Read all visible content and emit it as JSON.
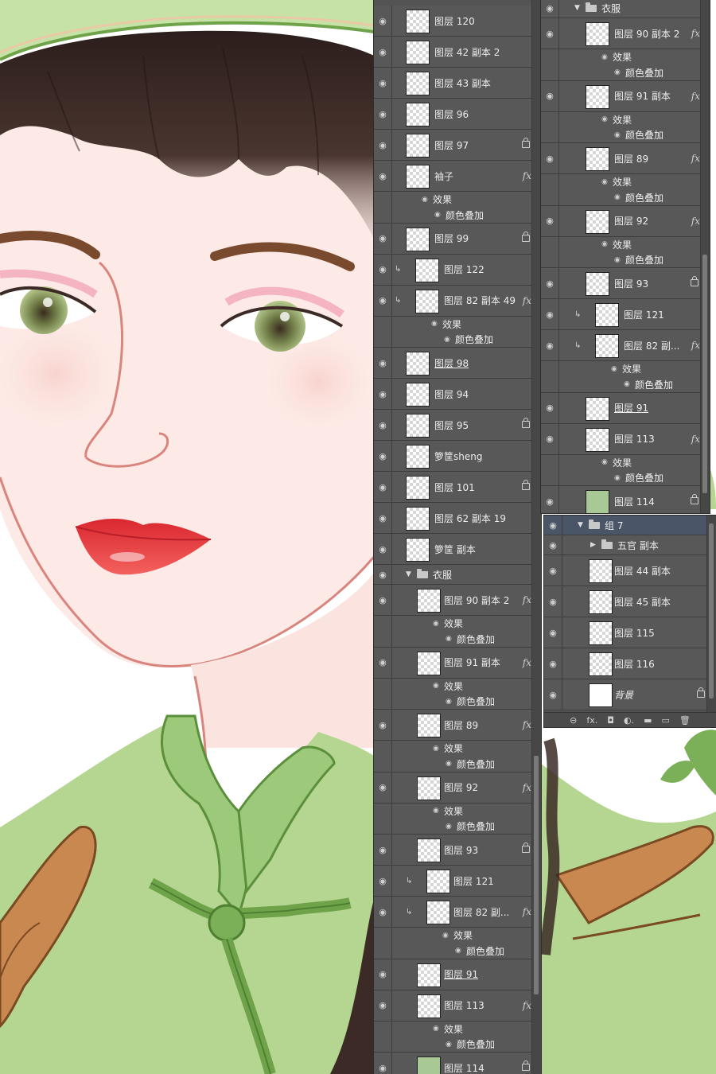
{
  "left_panel": {
    "top_layers": [
      {
        "name": "图层 120",
        "thumb": "pink",
        "fx": false,
        "lock": false,
        "clip": false
      },
      {
        "name": "图层 42 副本 2",
        "thumb": "check",
        "fx": false,
        "lock": false,
        "clip": false
      },
      {
        "name": "图层 43 副本",
        "thumb": "check",
        "fx": false,
        "lock": false,
        "clip": false
      },
      {
        "name": "图层 96",
        "thumb": "check",
        "fx": false,
        "lock": false,
        "clip": false
      },
      {
        "name": "图层 97",
        "thumb": "check",
        "fx": false,
        "lock": true,
        "clip": false
      },
      {
        "name": "袖子",
        "thumb": "check",
        "fx": true,
        "lock": false,
        "clip": false,
        "effects": [
          "效果",
          "颜色叠加"
        ]
      },
      {
        "name": "图层 99",
        "thumb": "check",
        "fx": false,
        "lock": true,
        "clip": false
      },
      {
        "name": "图层 122",
        "thumb": "check",
        "fx": false,
        "lock": false,
        "clip": true
      },
      {
        "name": "图层 82 副本 49",
        "thumb": "check",
        "fx": true,
        "lock": false,
        "clip": true,
        "effects": [
          "效果",
          "颜色叠加"
        ]
      },
      {
        "name": "图层 98",
        "thumb": "check",
        "fx": false,
        "lock": false,
        "clip": false,
        "underline": true
      },
      {
        "name": "图层 94",
        "thumb": "check",
        "fx": false,
        "lock": false,
        "clip": false
      },
      {
        "name": "图层 95",
        "thumb": "check",
        "fx": false,
        "lock": true,
        "clip": false
      },
      {
        "name": "箩筐sheng",
        "thumb": "check",
        "fx": false,
        "lock": false,
        "clip": false
      },
      {
        "name": "图层 101",
        "thumb": "check",
        "fx": false,
        "lock": true,
        "clip": false
      },
      {
        "name": "图层 62 副本 19",
        "thumb": "check",
        "fx": false,
        "lock": false,
        "clip": false
      },
      {
        "name": "箩筐 副本",
        "thumb": "check",
        "fx": false,
        "lock": false,
        "clip": false
      }
    ],
    "group": {
      "name": "衣服"
    },
    "group_layers": [
      {
        "name": "图层 90 副本 2",
        "fx": true,
        "lock": false,
        "clip": false,
        "effects": [
          "效果",
          "颜色叠加"
        ]
      },
      {
        "name": "图层 91 副本",
        "fx": true,
        "lock": false,
        "clip": false,
        "effects": [
          "效果",
          "颜色叠加"
        ]
      },
      {
        "name": "图层 89",
        "fx": true,
        "lock": false,
        "clip": false,
        "effects": [
          "效果",
          "颜色叠加"
        ]
      },
      {
        "name": "图层 92",
        "fx": true,
        "lock": false,
        "clip": false,
        "effects": [
          "效果",
          "颜色叠加"
        ]
      },
      {
        "name": "图层 93",
        "fx": false,
        "lock": true,
        "clip": false
      },
      {
        "name": "图层 121",
        "fx": false,
        "lock": false,
        "clip": true
      },
      {
        "name": "图层 82 副...",
        "fx": true,
        "lock": false,
        "clip": true,
        "effects": [
          "效果",
          "颜色叠加"
        ]
      },
      {
        "name": "图层 91",
        "fx": false,
        "lock": false,
        "clip": false,
        "underline": true
      },
      {
        "name": "图层 113",
        "fx": true,
        "lock": false,
        "clip": false,
        "effects": [
          "效果",
          "颜色叠加"
        ]
      },
      {
        "name": "图层 114",
        "fx": false,
        "lock": true,
        "clip": false,
        "thumb": "green"
      }
    ]
  },
  "right_panel_1": {
    "group": {
      "name": "衣服"
    },
    "layers": [
      {
        "name": "图层 90 副本 2",
        "fx": true,
        "lock": false,
        "clip": false,
        "effects": [
          "效果",
          "颜色叠加"
        ]
      },
      {
        "name": "图层 91 副本",
        "fx": true,
        "lock": false,
        "clip": false,
        "effects": [
          "效果",
          "颜色叠加"
        ]
      },
      {
        "name": "图层 89",
        "fx": true,
        "lock": false,
        "clip": false,
        "effects": [
          "效果",
          "颜色叠加"
        ]
      },
      {
        "name": "图层 92",
        "fx": true,
        "lock": false,
        "clip": false,
        "effects": [
          "效果",
          "颜色叠加"
        ]
      },
      {
        "name": "图层 93",
        "fx": false,
        "lock": true,
        "clip": false
      },
      {
        "name": "图层 121",
        "fx": false,
        "lock": false,
        "clip": true
      },
      {
        "name": "图层 82 副...",
        "fx": true,
        "lock": false,
        "clip": true,
        "effects": [
          "效果",
          "颜色叠加"
        ]
      },
      {
        "name": "图层 91",
        "fx": false,
        "lock": false,
        "clip": false,
        "underline": true
      },
      {
        "name": "图层 113",
        "fx": true,
        "lock": false,
        "clip": false,
        "effects": [
          "效果",
          "颜色叠加"
        ]
      },
      {
        "name": "图层 114",
        "fx": false,
        "lock": true,
        "clip": false,
        "thumb": "green"
      }
    ]
  },
  "right_panel_2": {
    "group": {
      "name": "组 7"
    },
    "subgroup": {
      "name": "五官 副本"
    },
    "layers": [
      {
        "name": "图层 44 副本",
        "lock": false
      },
      {
        "name": "图层 45 副本",
        "lock": false
      },
      {
        "name": "图层 115",
        "lock": false
      },
      {
        "name": "图层 116",
        "lock": false
      },
      {
        "name": "背景",
        "lock": true,
        "italic": true,
        "thumb": "white"
      }
    ],
    "footer_icons": [
      "link-icon",
      "fx-icon",
      "mask-icon",
      "adjustment-icon",
      "folder-icon",
      "new-layer-icon",
      "trash-icon"
    ],
    "footer_glyphs": [
      "⊖",
      "fx.",
      "◘",
      "◐.",
      "▬",
      "▭",
      "🗑"
    ]
  },
  "colors": {
    "panel_bg": "#535353",
    "row_bg": "#585858",
    "skin": "#fdeae6",
    "lips": "#e8383b",
    "cap_green": "#c7e2a6",
    "shirt_green": "#b4d690",
    "trim_green": "#6fa34a",
    "basket_brown": "#c9884f",
    "hair_dark": "#3b2a26"
  }
}
